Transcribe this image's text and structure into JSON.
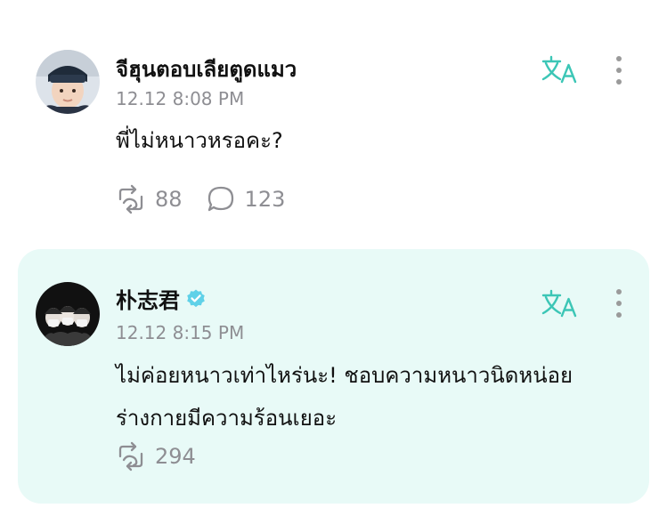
{
  "comments": [
    {
      "username": "จีฮุนตอบเลียตูดแมว",
      "timestamp": "12.12 8:08 PM",
      "text": "พี่ไม่หนาวหรอคะ?",
      "repost_count": "88",
      "reply_count": "123",
      "verified": false
    },
    {
      "username": "朴志君",
      "timestamp": "12.12 8:15 PM",
      "text": "ไม่ค่อยหนาวเท่าไหร่นะ! ชอบความหนาวนิดหน่อย ร่างกายมีความร้อนเยอะ",
      "repost_count": "294",
      "verified": true
    }
  ],
  "icons": {
    "translate": "translate-icon",
    "more": "more-vertical-icon",
    "repost": "repost-icon",
    "reply": "reply-bubble-icon",
    "verified": "verified-badge-icon"
  },
  "colors": {
    "accent": "#3cc6b6",
    "highlight_bg": "#e8faf7",
    "muted_text": "#8e8e93",
    "verified": "#5fd1e8"
  }
}
